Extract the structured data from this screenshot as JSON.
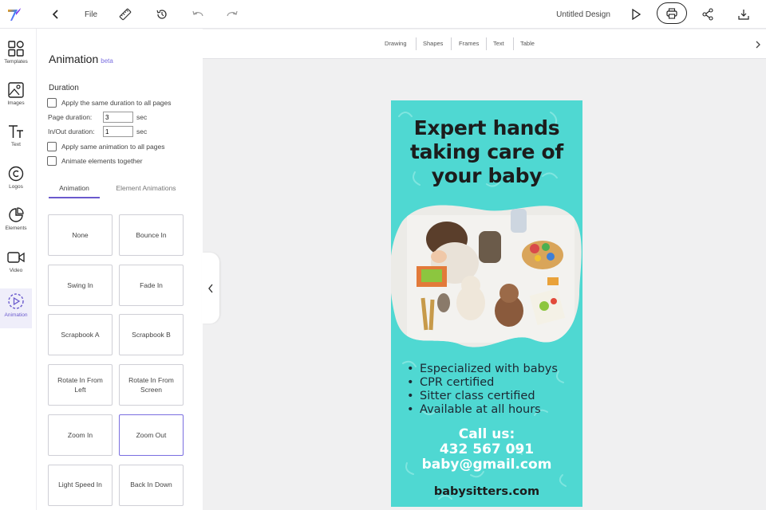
{
  "header": {
    "file_label": "File",
    "title": "Untitled Design",
    "icons": [
      "back-chevron-icon",
      "ruler-icon",
      "history-icon",
      "undo-icon",
      "redo-icon",
      "play-icon",
      "print-icon",
      "share-icon",
      "download-icon"
    ]
  },
  "rail": {
    "items": [
      {
        "label": "Templates",
        "icon": "templates-grid-icon"
      },
      {
        "label": "Images",
        "icon": "image-icon"
      },
      {
        "label": "Text",
        "icon": "text-icon"
      },
      {
        "label": "Logos",
        "icon": "copyright-icon"
      },
      {
        "label": "Elements",
        "icon": "pie-icon"
      },
      {
        "label": "Video",
        "icon": "video-camera-icon"
      },
      {
        "label": "Animation",
        "icon": "animation-play-icon",
        "active": true
      }
    ]
  },
  "panel": {
    "title": "Animation",
    "beta": "beta",
    "duration_heading": "Duration",
    "same_duration_label": "Apply the same duration to all pages",
    "page_duration_label": "Page duration:",
    "page_duration_value": "3",
    "inout_duration_label": "In/Out duration:",
    "inout_duration_value": "1",
    "unit": "sec",
    "same_animation_label": "Apply same animation to all pages",
    "animate_together_label": "Animate elements together",
    "tabs": [
      "Animation",
      "Element Animations"
    ],
    "animations": [
      "None",
      "Bounce In",
      "Swing In",
      "Fade In",
      "Scrapbook A",
      "Scrapbook B",
      "Rotate In From Left",
      "Rotate In From Screen",
      "Zoom In",
      "Zoom Out",
      "Light Speed In",
      "Back In Down"
    ],
    "selected_animation": "Zoom Out"
  },
  "toolbar": {
    "tools": [
      "Drawing",
      "Shapes",
      "Frames",
      "Text",
      "Table"
    ]
  },
  "design": {
    "headline": [
      "Expert hands",
      "taking care of",
      "your baby"
    ],
    "bullets": [
      "Especialized with babys",
      "CPR certified",
      "Sitter class certified",
      "Available at all hours"
    ],
    "call_lines": [
      "Call us:",
      "432 567 091",
      "baby@gmail.com"
    ],
    "website": "babysitters.com",
    "background_color": "#4fd8d2"
  },
  "colors": {
    "accent": "#6a5acd",
    "logo_gradient": [
      "#3b82f6",
      "#a855f7"
    ]
  }
}
